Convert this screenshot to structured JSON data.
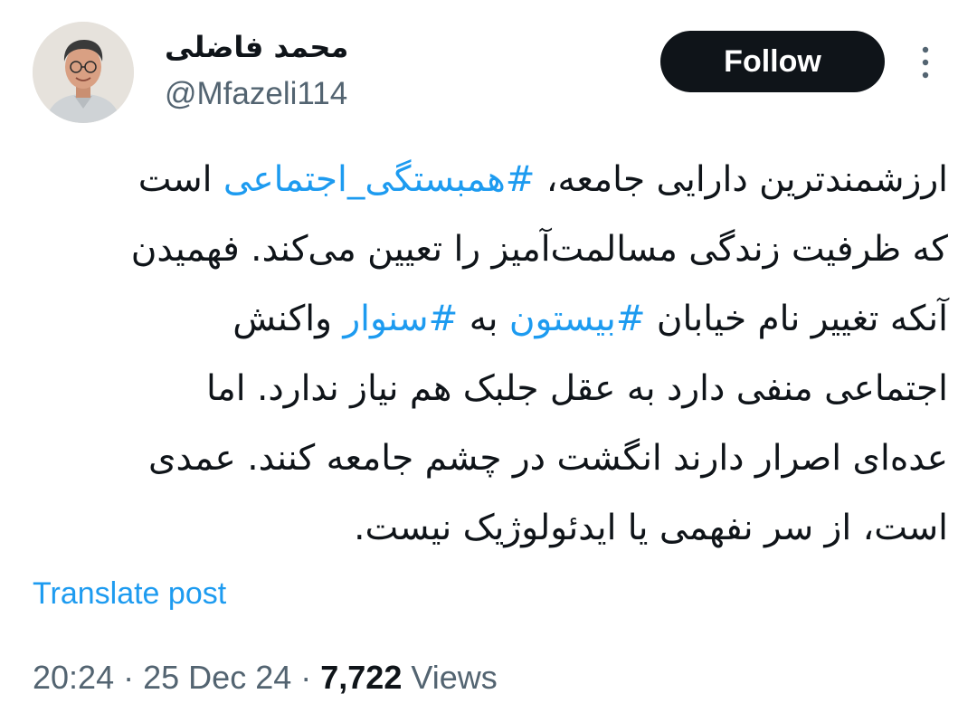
{
  "author": {
    "display_name": "محمد فاضلی",
    "handle": "@Mfazeli114"
  },
  "follow_button": {
    "label": "Follow"
  },
  "tweet": {
    "lines": [
      [
        {
          "text": "ارزشمندترین دارایی جامعه، ",
          "hashtag": false
        },
        {
          "text": "#همبستگی_اجتماعی",
          "hashtag": true
        },
        {
          "text": " است",
          "hashtag": false
        }
      ],
      [
        {
          "text": "که ظرفیت زندگی مسالمت‌آمیز را تعیین می‌کند. فهمیدن",
          "hashtag": false
        }
      ],
      [
        {
          "text": "آنکه تغییر نام خیابان ",
          "hashtag": false
        },
        {
          "text": "#بیستون",
          "hashtag": true
        },
        {
          "text": " به ",
          "hashtag": false
        },
        {
          "text": "#سنوار",
          "hashtag": true
        },
        {
          "text": " واکنش",
          "hashtag": false
        }
      ],
      [
        {
          "text": "اجتماعی منفی دارد به عقل جلبک هم نیاز ندارد. اما",
          "hashtag": false
        }
      ],
      [
        {
          "text": "عده‌ای اصرار دارند انگشت در چشم جامعه کنند. عمدی",
          "hashtag": false
        }
      ],
      [
        {
          "text": "است، از سر نفهمی یا ایدئولوژیک نیست.",
          "hashtag": false
        }
      ]
    ]
  },
  "translate": {
    "label": "Translate post"
  },
  "meta": {
    "time": "20:24",
    "date": "25 Dec 24",
    "separator": "·",
    "views_count": "7,722",
    "views_label": "Views"
  },
  "icons": {
    "more": "more-vertical-icon"
  },
  "colors": {
    "text": "#0f1419",
    "secondary": "#536471",
    "link": "#1d9bf0",
    "button": "#0f1419"
  }
}
